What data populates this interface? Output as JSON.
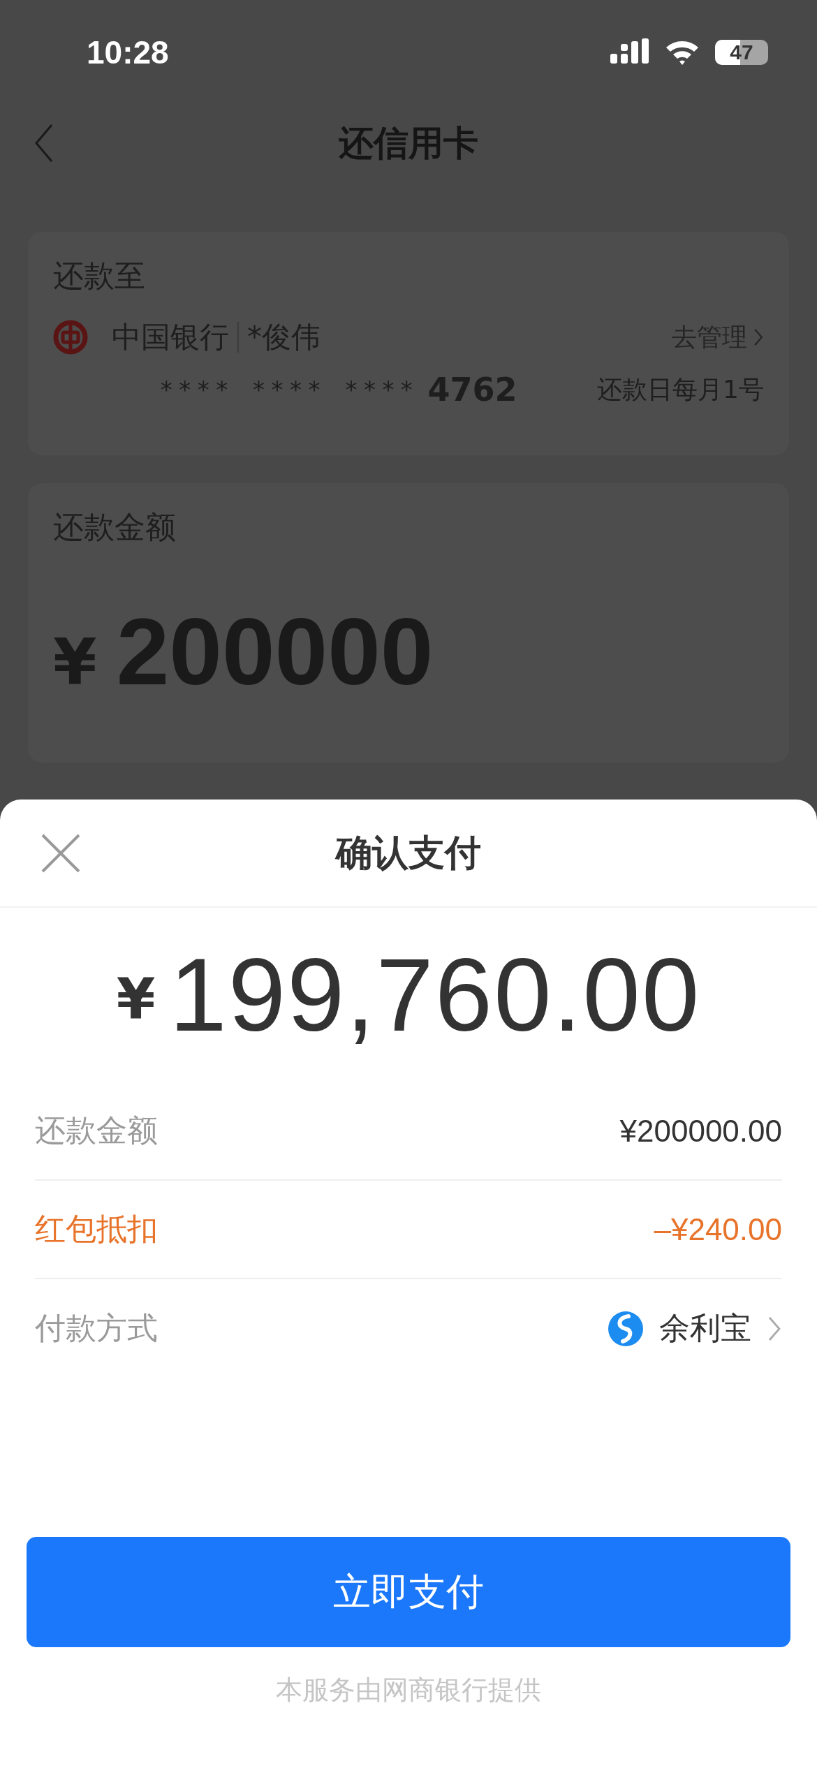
{
  "status_bar": {
    "time": "10:28",
    "battery": "47"
  },
  "header": {
    "title": "还信用卡"
  },
  "repay_to": {
    "label": "还款至",
    "bank": "中国银行",
    "holder": "*俊伟",
    "manage": "去管理",
    "card_mask": "**** **** ****",
    "card_last4": "4762",
    "due": "还款日每月1号"
  },
  "amount_card": {
    "label": "还款金额",
    "currency": "¥",
    "amount": "200000"
  },
  "sheet": {
    "title": "确认支付",
    "currency": "¥",
    "total": "199,760.00",
    "rows": [
      {
        "kind": "plain",
        "label": "还款金额",
        "value": "¥200000.00"
      },
      {
        "kind": "discount",
        "label": "红包抵扣",
        "value": "–¥240.00"
      },
      {
        "kind": "method",
        "label": "付款方式",
        "value": "余利宝"
      }
    ],
    "button": "立即支付",
    "footer": "本服务由网商银行提供"
  }
}
